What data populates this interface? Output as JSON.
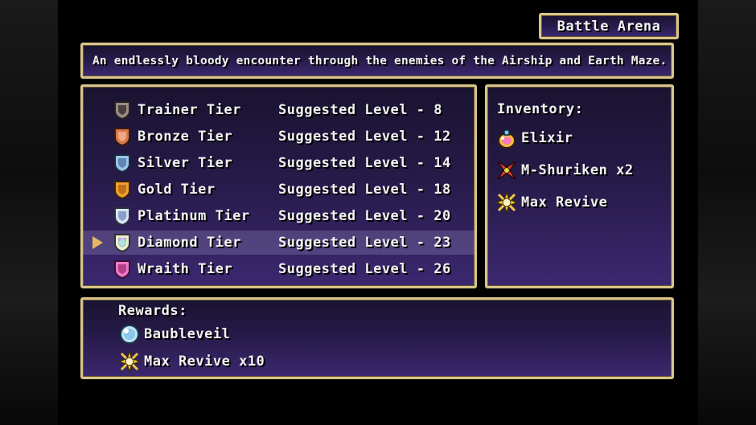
{
  "title": "Battle Arena",
  "description": "An endlessly bloody encounter through the enemies of the Airship and Earth Maze.",
  "tiers": [
    {
      "name": "Trainer Tier",
      "level": "Suggested Level - 8",
      "color": "#9a8c86"
    },
    {
      "name": "Bronze Tier",
      "level": "Suggested Level - 12",
      "color": "#d9784a"
    },
    {
      "name": "Silver Tier",
      "level": "Suggested Level - 14",
      "color": "#9cc4e8"
    },
    {
      "name": "Gold Tier",
      "level": "Suggested Level - 18",
      "color": "#f0a030"
    },
    {
      "name": "Platinum Tier",
      "level": "Suggested Level - 20",
      "color": "#d8e4f4"
    },
    {
      "name": "Diamond Tier",
      "level": "Suggested Level - 23",
      "color": "#e8f0c8"
    },
    {
      "name": "Wraith Tier",
      "level": "Suggested Level - 26",
      "color": "#f078c8"
    }
  ],
  "selected_tier": "Diamond Tier",
  "inventory": {
    "heading": "Inventory:",
    "items": [
      {
        "name": "Elixir",
        "icon": "elixir-icon"
      },
      {
        "name": "M-Shuriken x2",
        "icon": "shuriken-icon"
      },
      {
        "name": "Max Revive",
        "icon": "max-revive-icon"
      }
    ]
  },
  "rewards": {
    "heading": "Rewards:",
    "items": [
      {
        "name": "Baubleveil",
        "icon": "baubleveil-icon"
      },
      {
        "name": "Max Revive x10",
        "icon": "max-revive-icon"
      }
    ]
  },
  "colors": {
    "border": "#d9c48a",
    "window_top": "#1a1330",
    "window_bottom": "#3b2870",
    "cursor": "#e8b860"
  }
}
